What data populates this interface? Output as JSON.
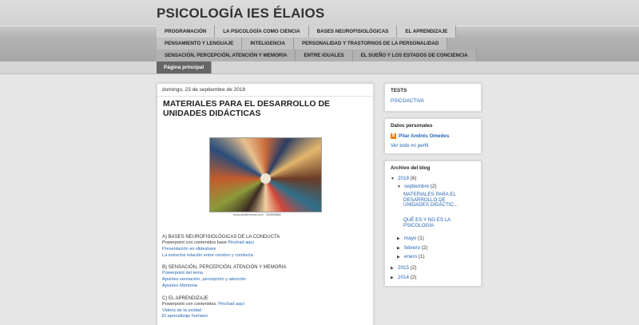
{
  "blog": {
    "title": "PSICOLOGÍA IES ÉLAIOS"
  },
  "tabs": {
    "row1": [
      "PROGRAMACIÓN",
      "LA PSICOLOGÍA COMO CIENCIA",
      "BASES NEUROFISIOLÓGICAS",
      "EL APRENDIZAJE"
    ],
    "row2": [
      "PENSAMIENTO Y LENGUAJE",
      "INTELIGENCIA",
      "PERSONALIDAD Y TRASTORNOS DE LA PERSONALIDAD"
    ],
    "row3": [
      "SENSACIÓN, PERCEPCIÓN, ATENCIÓN Y MEMORIA",
      "ENTRE IGUALES",
      "EL SUEÑO Y LOS ESTADOS DE CONCIENCIA"
    ],
    "row4": [
      "Página principal"
    ]
  },
  "post": {
    "date": "domingo, 23 de septiembre de 2018",
    "title": "MATERIALES PARA EL DESARROLLO DE UNIDADES DIDÁCTICAS",
    "image_caption": "www.shutterstock.com · 305858882",
    "sections": [
      {
        "heading": "A) BASES NEUROFISIOLÓGICAS DE LA CONDUCTA",
        "line1_text": "Powerpoint con contenidos base ",
        "line1_link": "Pinchad aquí",
        "line2": "Presentación en slideshare",
        "line3": "La estrecha relación entre cerebro y conducta"
      },
      {
        "heading": "B) SENSACIÓN, PERCEPCIÓN, ATENCIÓN Y  MEMORIA",
        "line1": "Powerpoint del tema",
        "line2": "Apuntes sensación, percepción y atención",
        "line3": "Apuntes Memoria"
      },
      {
        "heading": "C) EL APRENDIZAJE",
        "line1_text": "Powerpoint con contenidos. ",
        "line1_link": "Pinchad aquí",
        "line2": "Videos de la unidad",
        "line3": "El aprendizaje humano"
      }
    ]
  },
  "sidebar": {
    "tests": {
      "title": "TESTS",
      "link": "PSICOACTIVA"
    },
    "profile": {
      "title": "Datos personales",
      "name": "Pilar Andrés Omedes",
      "view": "Ver todo mi perfil"
    },
    "archive": {
      "title": "Archivo del blog",
      "year1": "2018",
      "year1_count": "(6)",
      "month_open": "septiembre",
      "month_open_count": "(2)",
      "posts": [
        "MATERIALES PARA EL DESARROLLO DE UNIDADES DIDÁCTIC...",
        "QUÉ ES Y NO ES LA PSICOLOGÍA"
      ],
      "months": [
        {
          "name": "mayo",
          "count": "(1)"
        },
        {
          "name": "febrero",
          "count": "(2)"
        },
        {
          "name": "enero",
          "count": "(1)"
        }
      ],
      "years": [
        {
          "name": "2015",
          "count": "(2)"
        },
        {
          "name": "2014",
          "count": "(2)"
        }
      ]
    }
  },
  "icons": {
    "blogger": "blogger-icon",
    "expanded": "triangle-down-icon",
    "collapsed": "triangle-right-icon"
  }
}
